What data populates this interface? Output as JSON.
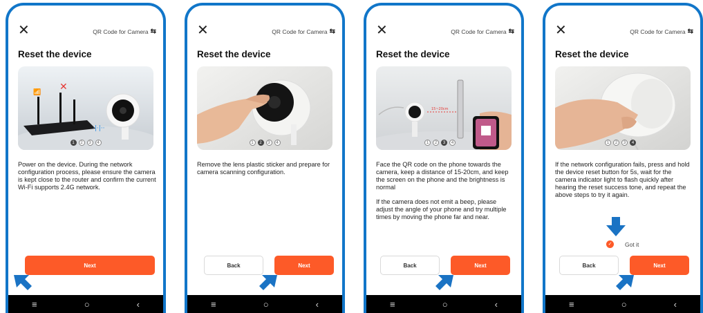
{
  "header": {
    "qr_link": "QR Code for Camera",
    "close_icon": "close-icon",
    "switch_icon": "swap-icon"
  },
  "screens": [
    {
      "title": "Reset the device",
      "dots": [
        "1",
        "2",
        "3",
        "4"
      ],
      "active_dot": 0,
      "paragraphs": [
        "Power on the device. During the network configuration process, please ensure the camera is kept close to the router and confirm the current Wi-Fi supports 2.4G network."
      ],
      "next_label": "Next"
    },
    {
      "title": "Reset the device",
      "dots": [
        "1",
        "2",
        "3",
        "4"
      ],
      "active_dot": 1,
      "paragraphs": [
        "Remove the lens plastic sticker and prepare for camera scanning configuration."
      ],
      "back_label": "Back",
      "next_label": "Next"
    },
    {
      "title": "Reset the device",
      "dots": [
        "1",
        "2",
        "3",
        "4"
      ],
      "active_dot": 2,
      "paragraphs": [
        "Face the QR code on the phone towards the camera, keep a distance of 15-20cm, and keep the screen on the phone and the brightness is normal",
        "If the camera does not emit a beep, please adjust the angle of your phone and try multiple times by moving the phone far and near."
      ],
      "photo_label": "15~20cm",
      "back_label": "Back",
      "next_label": "Next"
    },
    {
      "title": "Reset the device",
      "dots": [
        "1",
        "2",
        "3",
        "4"
      ],
      "active_dot": 3,
      "paragraphs": [
        "If the network configuration fails, press and hold the device reset button for 5s, wait for the camera indicator light to flash quickly after hearing the reset success tone, and repeat the above steps to try it again."
      ],
      "got_it": "Got it",
      "back_label": "Back",
      "next_label": "Next"
    }
  ],
  "navbar": {
    "menu": "≡",
    "home": "○",
    "back": "‹"
  },
  "colors": {
    "frame": "#1176c9",
    "accent": "#fd5a28",
    "arrow": "#1a73c4"
  }
}
